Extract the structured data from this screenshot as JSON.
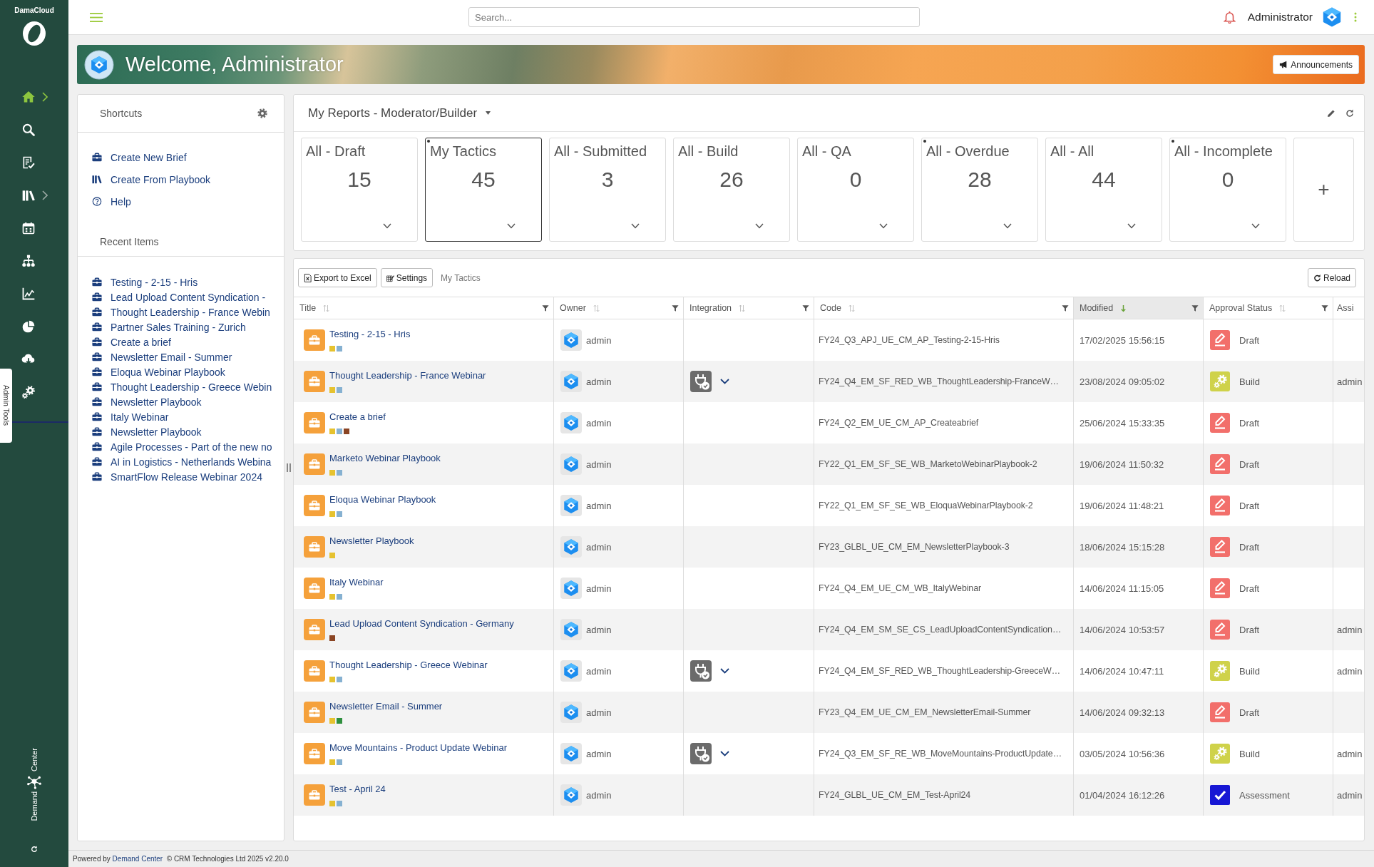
{
  "sidebar": {
    "brand": "DamaCloud",
    "nav_items": [
      {
        "kind": "home",
        "selected": true,
        "submenu": true
      },
      {
        "kind": "search",
        "selected": false,
        "submenu": false
      },
      {
        "kind": "tasks",
        "selected": false,
        "submenu": false
      },
      {
        "kind": "library",
        "selected": false,
        "submenu": true
      },
      {
        "kind": "calendar",
        "selected": false,
        "submenu": false
      },
      {
        "kind": "hierarchy",
        "selected": false,
        "submenu": false
      },
      {
        "kind": "analytics",
        "selected": false,
        "submenu": false
      },
      {
        "kind": "reports",
        "selected": false,
        "submenu": false
      },
      {
        "kind": "download",
        "selected": false,
        "submenu": false
      },
      {
        "kind": "admin",
        "selected": false,
        "submenu": false
      }
    ],
    "admin_tab": "Admin Tools",
    "footer_logo": [
      "Demand",
      "Center"
    ]
  },
  "topbar": {
    "search": {
      "placeholder": "Search..."
    },
    "user": "Administrator"
  },
  "banner": {
    "title": "Welcome, Administrator",
    "button": "Announcements"
  },
  "shortcuts": {
    "title": "Shortcuts",
    "items": [
      {
        "kind": "brief",
        "label": "Create New Brief"
      },
      {
        "kind": "playbook",
        "label": "Create From Playbook"
      },
      {
        "kind": "help",
        "label": "Help"
      }
    ],
    "recent_title": "Recent Items",
    "recent_items": [
      "Testing - 2-15 - Hris",
      "Lead Upload Content Syndication -",
      "Thought Leadership - France Webin",
      "Partner Sales Training - Zurich",
      "Create a brief",
      "Newsletter Email - Summer",
      "Eloqua Webinar Playbook",
      "Thought Leadership - Greece Webin",
      "Newsletter Playbook",
      "Italy Webinar",
      "Newsletter Playbook",
      "Agile Processes - Part of the new no",
      "AI in Logistics - Netherlands Webina",
      "SmartFlow Release Webinar 2024"
    ]
  },
  "reports": {
    "title": "My Reports - Moderator/Builder",
    "tiles": [
      {
        "label": "All - Draft",
        "count": "15",
        "selected": false,
        "flagged": false
      },
      {
        "label": "My Tactics",
        "count": "45",
        "selected": true,
        "flagged": true
      },
      {
        "label": "All - Submitted",
        "count": "3",
        "selected": false,
        "flagged": false
      },
      {
        "label": "All - Build",
        "count": "26",
        "selected": false,
        "flagged": false
      },
      {
        "label": "All - QA",
        "count": "0",
        "selected": false,
        "flagged": false
      },
      {
        "label": "All - Overdue",
        "count": "28",
        "selected": false,
        "flagged": true
      },
      {
        "label": "All - All",
        "count": "44",
        "selected": false,
        "flagged": false
      },
      {
        "label": "All - Incomplete",
        "count": "0",
        "selected": false,
        "flagged": true
      }
    ],
    "add_tile": "+"
  },
  "table": {
    "toolbar": {
      "buttons": [
        {
          "kind": "export",
          "label": "Export to Excel"
        },
        {
          "kind": "settings",
          "label": "Settings"
        }
      ],
      "view_name": "My Tactics",
      "reload": "Reload"
    },
    "columns": [
      {
        "label": "Title",
        "sorted": false,
        "filterable": true
      },
      {
        "label": "Owner",
        "sorted": false,
        "filterable": true
      },
      {
        "label": "Integration",
        "sorted": false,
        "filterable": true
      },
      {
        "label": "Code",
        "sorted": false,
        "filterable": true
      },
      {
        "label": "Modified",
        "sorted": true,
        "filterable": true
      },
      {
        "label": "Approval Status",
        "sorted": false,
        "filterable": true
      },
      {
        "label": "Assi"
      }
    ],
    "rows": [
      {
        "title": "Testing - 2-15 - Hris",
        "tags": [
          {
            "color": "#e6c22f"
          },
          {
            "color": "#86b1d1"
          }
        ],
        "owner": "admin",
        "integration": false,
        "code": "FY24_Q3_APJ_UE_CM_AP_Testing-2-15-Hris",
        "modified": "17/02/2025 15:56:15",
        "status": {
          "kind": "draft",
          "label": "Draft"
        }
      },
      {
        "title": "Thought Leadership - France Webinar",
        "tags": [
          {
            "color": "#e6c22f"
          },
          {
            "color": "#86b1d1"
          }
        ],
        "owner": "admin",
        "integration": true,
        "code": "FY24_Q4_EM_SF_RED_WB_ThoughtLeadership-FranceW…",
        "modified": "23/08/2024 09:05:02",
        "status": {
          "kind": "build",
          "label": "Build"
        },
        "assignee": "admin"
      },
      {
        "title": "Create a brief",
        "tags": [
          {
            "color": "#e6c22f"
          },
          {
            "color": "#86b1d1"
          },
          {
            "color": "#8a4423"
          }
        ],
        "owner": "admin",
        "integration": false,
        "code": "FY24_Q2_EM_UE_CM_AP_Createabrief",
        "modified": "25/06/2024 15:33:35",
        "status": {
          "kind": "draft",
          "label": "Draft"
        }
      },
      {
        "title": "Marketo Webinar Playbook",
        "tags": [
          {
            "color": "#e6c22f"
          },
          {
            "color": "#86b1d1"
          }
        ],
        "owner": "admin",
        "integration": false,
        "code": "FY22_Q1_EM_SF_SE_WB_MarketoWebinarPlaybook-2",
        "modified": "19/06/2024 11:50:32",
        "status": {
          "kind": "draft",
          "label": "Draft"
        }
      },
      {
        "title": "Eloqua Webinar Playbook",
        "tags": [
          {
            "color": "#e6c22f"
          },
          {
            "color": "#86b1d1"
          }
        ],
        "owner": "admin",
        "integration": false,
        "code": "FY22_Q1_EM_SF_SE_WB_EloquaWebinarPlaybook-2",
        "modified": "19/06/2024 11:48:21",
        "status": {
          "kind": "draft",
          "label": "Draft"
        }
      },
      {
        "title": "Newsletter Playbook",
        "tags": [
          {
            "color": "#e6c22f"
          }
        ],
        "owner": "admin",
        "integration": false,
        "code": "FY23_GLBL_UE_CM_EM_NewsletterPlaybook-3",
        "modified": "18/06/2024 15:15:28",
        "status": {
          "kind": "draft",
          "label": "Draft"
        }
      },
      {
        "title": "Italy Webinar",
        "tags": [
          {
            "color": "#e6c22f"
          },
          {
            "color": "#86b1d1"
          }
        ],
        "owner": "admin",
        "integration": false,
        "code": "FY24_Q4_EM_UE_CM_WB_ItalyWebinar",
        "modified": "14/06/2024 11:15:05",
        "status": {
          "kind": "draft",
          "label": "Draft"
        }
      },
      {
        "title": "Lead Upload Content Syndication - Germany",
        "tags": [
          {
            "color": "#8a4423"
          }
        ],
        "owner": "admin",
        "integration": false,
        "code": "FY24_Q4_EM_SM_SE_CS_LeadUploadContentSyndication…",
        "modified": "14/06/2024 10:53:57",
        "status": {
          "kind": "draft",
          "label": "Draft"
        },
        "assignee": "admin"
      },
      {
        "title": "Thought Leadership - Greece Webinar",
        "tags": [
          {
            "color": "#e6c22f"
          },
          {
            "color": "#86b1d1"
          }
        ],
        "owner": "admin",
        "integration": true,
        "code": "FY24_Q4_EM_SF_RED_WB_ThoughtLeadership-GreeceW…",
        "modified": "14/06/2024 10:47:11",
        "status": {
          "kind": "build",
          "label": "Build"
        },
        "assignee": "admin"
      },
      {
        "title": "Newsletter Email - Summer",
        "tags": [
          {
            "color": "#e6c22f"
          },
          {
            "color": "#2f8f3e"
          }
        ],
        "owner": "admin",
        "integration": false,
        "code": "FY23_Q4_EM_UE_CM_EM_NewsletterEmail-Summer",
        "modified": "14/06/2024 09:32:13",
        "status": {
          "kind": "draft",
          "label": "Draft"
        }
      },
      {
        "title": "Move Mountains - Product Update Webinar",
        "tags": [
          {
            "color": "#e6c22f"
          },
          {
            "color": "#86b1d1"
          }
        ],
        "owner": "admin",
        "integration": true,
        "code": "FY24_Q3_EM_SF_RE_WB_MoveMountains-ProductUpdate…",
        "modified": "03/05/2024 10:56:36",
        "status": {
          "kind": "build",
          "label": "Build"
        },
        "assignee": "admin"
      },
      {
        "title": "Test - April 24",
        "tags": [
          {
            "color": "#e6c22f"
          },
          {
            "color": "#86b1d1"
          }
        ],
        "owner": "admin",
        "integration": false,
        "code": "FY24_GLBL_UE_CM_EM_Test-April24",
        "modified": "01/04/2024 16:12:26",
        "status": {
          "kind": "assessment",
          "label": "Assessment"
        },
        "assignee": "admin"
      }
    ]
  },
  "footer": {
    "before": "Powered by",
    "link": "Demand Center",
    "after": "© CRM Technologies Ltd 2025 v2.20.0"
  }
}
